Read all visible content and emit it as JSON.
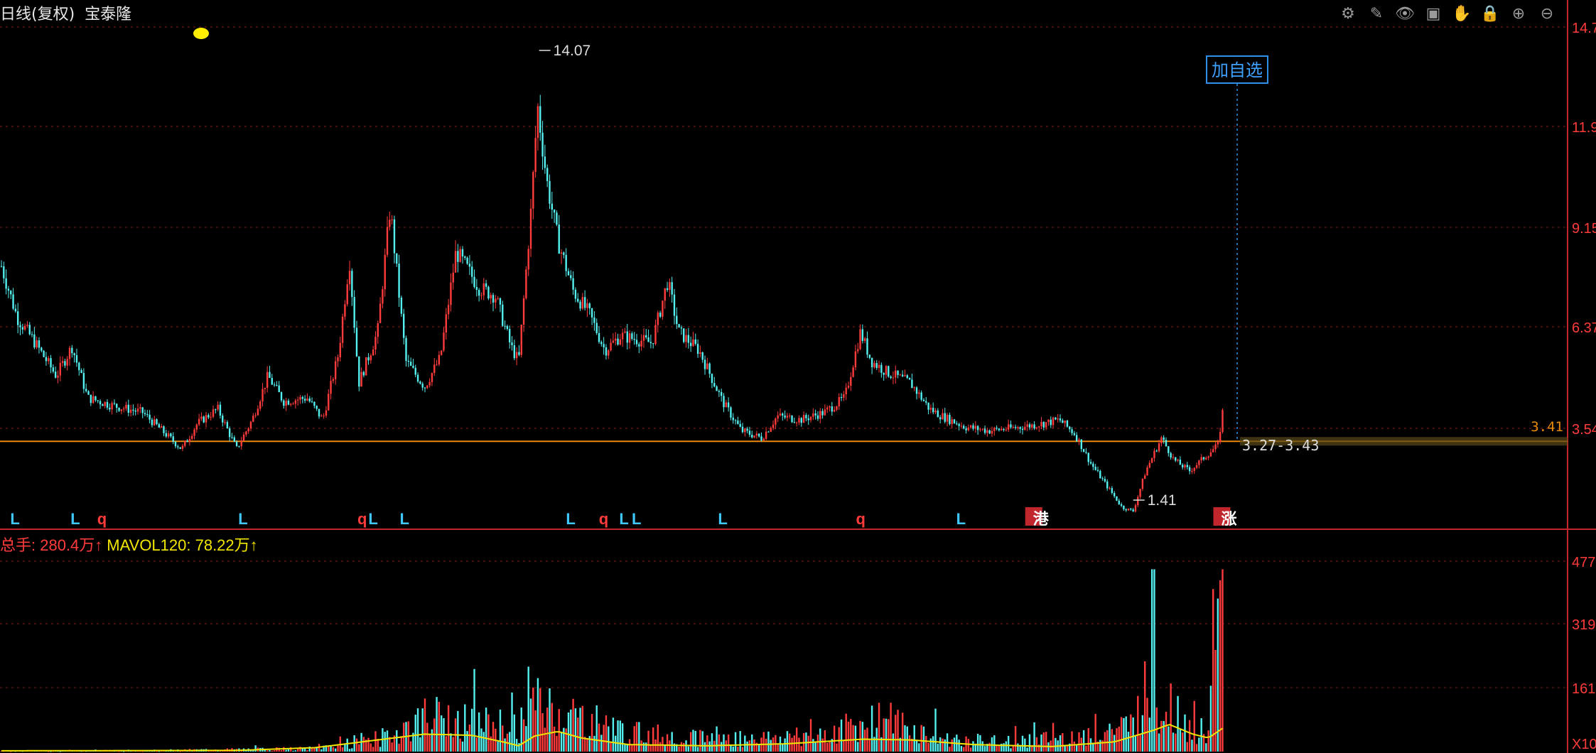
{
  "header": {
    "title_prefix": "日线(复权)",
    "stock_name": "宝泰隆",
    "indicator_dot_color": "#ffee00"
  },
  "toolbar": {
    "icons": [
      "gear-icon",
      "pen-icon",
      "eye-icon",
      "toolbox-icon",
      "hand-icon",
      "lock-icon",
      "zoom-in-icon",
      "zoom-out-icon"
    ]
  },
  "add_watch_label": "加自选",
  "annotations": {
    "high_label": "14.07",
    "low_label": "1.41",
    "range_label": "3.27-3.43",
    "last_price_label": "3.41"
  },
  "volume_legend": {
    "volume_text": "总手: 280.4万↑",
    "mavol_text": "MAVOL120: 78.22万↑"
  },
  "signals": [
    {
      "t": "L",
      "x": 0.0065,
      "c": "#3ec8ff"
    },
    {
      "t": "L",
      "x": 0.045,
      "c": "#3ec8ff"
    },
    {
      "t": "q",
      "x": 0.062,
      "c": "#ff3b3b"
    },
    {
      "t": "L",
      "x": 0.152,
      "c": "#3ec8ff"
    },
    {
      "t": "q",
      "x": 0.228,
      "c": "#ff3b3b"
    },
    {
      "t": "L",
      "x": 0.235,
      "c": "#3ec8ff"
    },
    {
      "t": "L",
      "x": 0.255,
      "c": "#3ec8ff"
    },
    {
      "t": "L",
      "x": 0.361,
      "c": "#3ec8ff"
    },
    {
      "t": "q",
      "x": 0.382,
      "c": "#ff3b3b"
    },
    {
      "t": "L",
      "x": 0.395,
      "c": "#3ec8ff"
    },
    {
      "t": "L",
      "x": 0.403,
      "c": "#3ec8ff"
    },
    {
      "t": "L",
      "x": 0.458,
      "c": "#3ec8ff"
    },
    {
      "t": "q",
      "x": 0.546,
      "c": "#ff3b3b"
    },
    {
      "t": "L",
      "x": 0.61,
      "c": "#3ec8ff"
    },
    {
      "t": "港",
      "x": 0.659,
      "c": "#ffffff",
      "bg": "#c0262c"
    },
    {
      "t": "涨",
      "x": 0.779,
      "c": "#ffffff",
      "bg": "#c0262c"
    }
  ],
  "chart_data": [
    {
      "type": "candlestick",
      "title": "",
      "y_ticks": [
        "3.54",
        "6.37",
        "9.15",
        "11.9",
        "14.7"
      ],
      "ylim": [
        1.2,
        14.7
      ],
      "reference_line": 3.41,
      "high": 14.07,
      "low": 1.41,
      "x_range_fraction_of_chart_with_data": [
        0.0,
        0.779
      ],
      "colors": {
        "up": "#ff3b3b",
        "down": "#54f0f0",
        "ref": "#e8890c",
        "grid": "#8b1a1a"
      },
      "close_profile": [
        [
          0.0,
          8.2
        ],
        [
          0.01,
          6.8
        ],
        [
          0.02,
          6.2
        ],
        [
          0.035,
          5.2
        ],
        [
          0.045,
          6.0
        ],
        [
          0.055,
          4.6
        ],
        [
          0.07,
          4.4
        ],
        [
          0.09,
          4.2
        ],
        [
          0.105,
          3.6
        ],
        [
          0.115,
          3.2
        ],
        [
          0.125,
          3.9
        ],
        [
          0.138,
          4.3
        ],
        [
          0.15,
          3.2
        ],
        [
          0.16,
          4.0
        ],
        [
          0.17,
          5.2
        ],
        [
          0.18,
          4.5
        ],
        [
          0.195,
          4.6
        ],
        [
          0.205,
          4.0
        ],
        [
          0.215,
          5.8
        ],
        [
          0.222,
          8.4
        ],
        [
          0.228,
          5.0
        ],
        [
          0.24,
          6.4
        ],
        [
          0.248,
          9.8
        ],
        [
          0.258,
          5.6
        ],
        [
          0.27,
          4.9
        ],
        [
          0.28,
          5.7
        ],
        [
          0.29,
          8.6
        ],
        [
          0.305,
          7.6
        ],
        [
          0.315,
          7.4
        ],
        [
          0.325,
          6.0
        ],
        [
          0.33,
          5.6
        ],
        [
          0.338,
          9.8
        ],
        [
          0.342,
          12.6
        ],
        [
          0.348,
          10.5
        ],
        [
          0.355,
          8.9
        ],
        [
          0.365,
          7.5
        ],
        [
          0.375,
          6.9
        ],
        [
          0.385,
          5.9
        ],
        [
          0.395,
          6.3
        ],
        [
          0.405,
          6.2
        ],
        [
          0.415,
          6.1
        ],
        [
          0.425,
          7.8
        ],
        [
          0.432,
          6.4
        ],
        [
          0.445,
          5.9
        ],
        [
          0.46,
          4.5
        ],
        [
          0.472,
          3.7
        ],
        [
          0.485,
          3.5
        ],
        [
          0.495,
          4.1
        ],
        [
          0.51,
          4.0
        ],
        [
          0.525,
          4.2
        ],
        [
          0.538,
          4.6
        ],
        [
          0.548,
          6.4
        ],
        [
          0.555,
          5.6
        ],
        [
          0.565,
          5.3
        ],
        [
          0.58,
          5.0
        ],
        [
          0.592,
          4.3
        ],
        [
          0.6,
          4.1
        ],
        [
          0.615,
          3.8
        ],
        [
          0.63,
          3.7
        ],
        [
          0.65,
          3.8
        ],
        [
          0.665,
          3.9
        ],
        [
          0.675,
          4.0
        ],
        [
          0.685,
          3.6
        ],
        [
          0.695,
          2.8
        ],
        [
          0.705,
          2.2
        ],
        [
          0.715,
          1.6
        ],
        [
          0.722,
          1.5
        ],
        [
          0.73,
          2.6
        ],
        [
          0.74,
          3.5
        ],
        [
          0.748,
          2.9
        ],
        [
          0.758,
          2.6
        ],
        [
          0.768,
          3.0
        ],
        [
          0.776,
          3.3
        ],
        [
          0.779,
          4.2
        ]
      ]
    },
    {
      "type": "bar",
      "title": "",
      "series": [
        {
          "name": "总手"
        },
        {
          "name": "MAVOL120"
        }
      ],
      "y_ticks": [
        "X10",
        "161",
        "319",
        "477"
      ],
      "ylim": [
        0,
        500
      ],
      "volume_profile": [
        [
          0.0,
          3
        ],
        [
          0.1,
          4
        ],
        [
          0.2,
          10
        ],
        [
          0.24,
          40
        ],
        [
          0.26,
          80
        ],
        [
          0.28,
          110
        ],
        [
          0.3,
          90
        ],
        [
          0.33,
          80
        ],
        [
          0.34,
          150
        ],
        [
          0.36,
          120
        ],
        [
          0.4,
          60
        ],
        [
          0.43,
          50
        ],
        [
          0.47,
          40
        ],
        [
          0.5,
          45
        ],
        [
          0.53,
          60
        ],
        [
          0.56,
          110
        ],
        [
          0.58,
          70
        ],
        [
          0.6,
          40
        ],
        [
          0.64,
          30
        ],
        [
          0.67,
          40
        ],
        [
          0.7,
          60
        ],
        [
          0.72,
          80
        ],
        [
          0.73,
          180
        ],
        [
          0.74,
          130
        ],
        [
          0.75,
          140
        ],
        [
          0.76,
          60
        ],
        [
          0.77,
          80
        ],
        [
          0.779,
          470
        ]
      ],
      "mavol_profile": [
        [
          0.0,
          2
        ],
        [
          0.15,
          3
        ],
        [
          0.2,
          10
        ],
        [
          0.24,
          30
        ],
        [
          0.27,
          45
        ],
        [
          0.3,
          42
        ],
        [
          0.32,
          25
        ],
        [
          0.33,
          15
        ],
        [
          0.34,
          40
        ],
        [
          0.355,
          52
        ],
        [
          0.37,
          35
        ],
        [
          0.4,
          18
        ],
        [
          0.45,
          15
        ],
        [
          0.5,
          20
        ],
        [
          0.55,
          32
        ],
        [
          0.58,
          30
        ],
        [
          0.62,
          18
        ],
        [
          0.67,
          13
        ],
        [
          0.71,
          25
        ],
        [
          0.735,
          55
        ],
        [
          0.745,
          70
        ],
        [
          0.76,
          45
        ],
        [
          0.77,
          35
        ],
        [
          0.779,
          60
        ]
      ]
    }
  ]
}
